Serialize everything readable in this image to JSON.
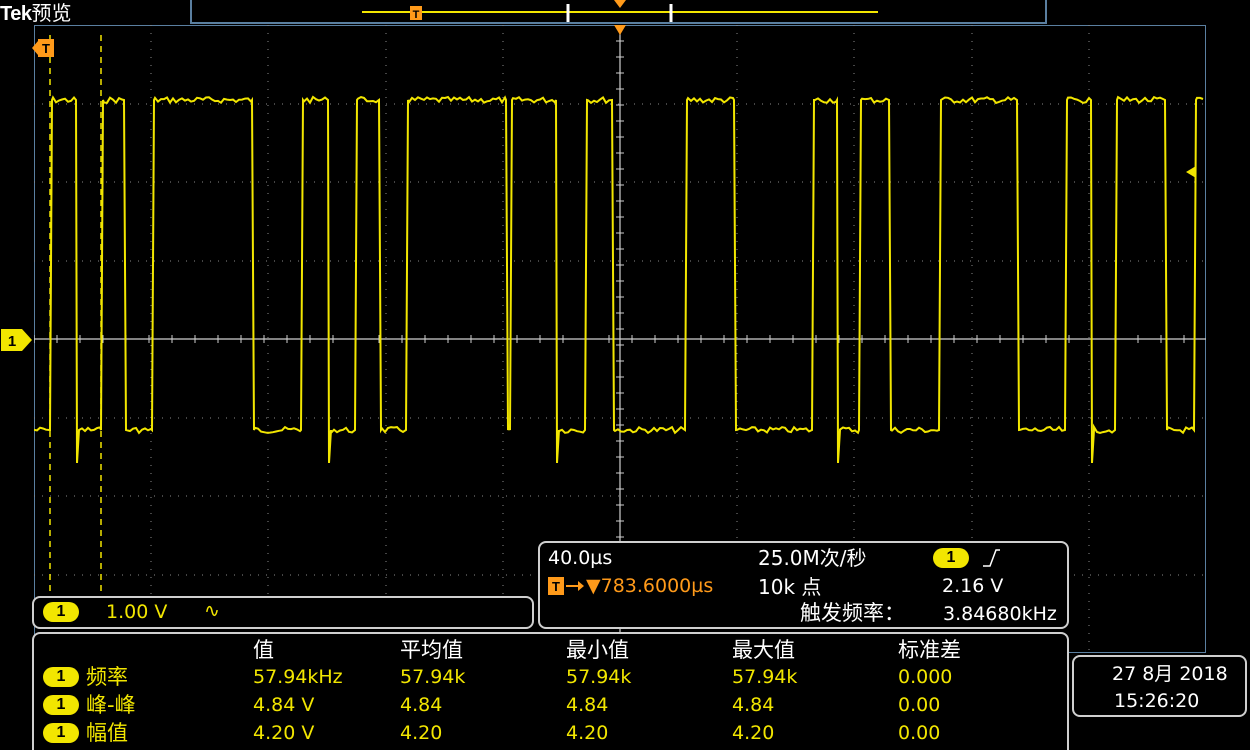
{
  "header": {
    "brand": "Tek",
    "mode": "预览"
  },
  "channel": {
    "id": "1",
    "scale": "1.00 V",
    "coupling_icon": "∿"
  },
  "horizontal": {
    "timebase": "40.0µs",
    "sample_rate": "25.0M次/秒",
    "trigger_channel": "1",
    "trigger_slope_icon": "rising-edge-icon",
    "trigger_position": "▼783.6000µs",
    "record_length": "10k 点",
    "trigger_level": "2.16 V",
    "trigger_freq_label": "触发频率：",
    "trigger_freq": "3.84680kHz"
  },
  "measurements": {
    "headers": [
      "值",
      "平均值",
      "最小值",
      "最大值",
      "标准差"
    ],
    "rows": [
      {
        "channel": "1",
        "name": "频率",
        "values": [
          "57.94kHz",
          "57.94k",
          "57.94k",
          "57.94k",
          "0.000"
        ]
      },
      {
        "channel": "1",
        "name": "峰-峰",
        "values": [
          "4.84 V",
          "4.84",
          "4.84",
          "4.84",
          "0.00"
        ]
      },
      {
        "channel": "1",
        "name": "幅值",
        "values": [
          "4.20 V",
          "4.20",
          "4.20",
          "4.20",
          "0.00"
        ]
      }
    ]
  },
  "datetime": {
    "date": "27 8月 2018",
    "time": "15:26:20"
  },
  "colors": {
    "trace": "#f2e600",
    "trigger": "#ff9a1a",
    "frame": "#5a7fa0",
    "grid": "#8a8a8a"
  }
}
